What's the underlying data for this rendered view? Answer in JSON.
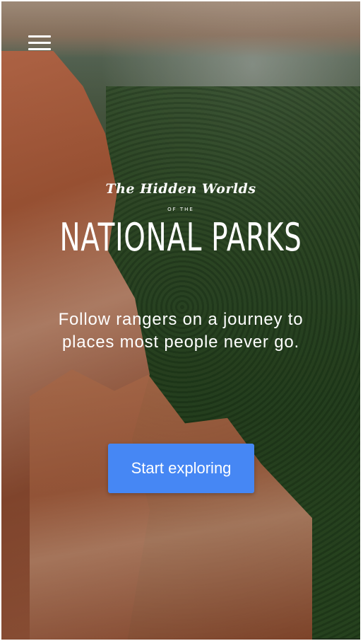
{
  "header": {
    "menu_icon": "hamburger-menu-icon"
  },
  "hero": {
    "script_title": "The Hidden Worlds",
    "small_of": "OF THE",
    "title": "NATIONAL PARKS",
    "tagline": "Follow rangers on a journey to places most people never go."
  },
  "cta": {
    "label": "Start exploring"
  },
  "colors": {
    "button": "#4687f4",
    "text": "#ffffff"
  }
}
